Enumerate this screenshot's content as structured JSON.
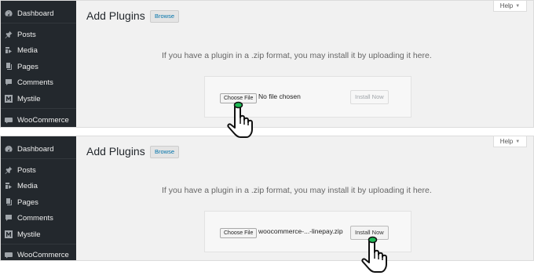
{
  "panels": [
    {
      "sidebar": {
        "items": [
          {
            "label": "Dashboard",
            "icon": "dashboard-icon"
          },
          {
            "label": "Posts",
            "icon": "pin-icon"
          },
          {
            "label": "Media",
            "icon": "media-icon"
          },
          {
            "label": "Pages",
            "icon": "pages-icon"
          },
          {
            "label": "Comments",
            "icon": "comment-icon"
          },
          {
            "label": "Mystile",
            "icon": "mystile-icon"
          },
          {
            "label": "WooCommerce",
            "icon": "woocommerce-icon"
          }
        ]
      },
      "page_title": "Add Plugins",
      "browse_label": "Browse",
      "help_label": "Help",
      "instruction": "If you have a plugin in a .zip format, you may install it by uploading it here.",
      "choose_file_label": "Choose File",
      "file_status": "No file chosen",
      "install_label": "Install Now",
      "install_enabled": false,
      "pointer_target": "choose-file-button"
    },
    {
      "sidebar": {
        "items": [
          {
            "label": "Dashboard",
            "icon": "dashboard-icon"
          },
          {
            "label": "Posts",
            "icon": "pin-icon"
          },
          {
            "label": "Media",
            "icon": "media-icon"
          },
          {
            "label": "Pages",
            "icon": "pages-icon"
          },
          {
            "label": "Comments",
            "icon": "comment-icon"
          },
          {
            "label": "Mystile",
            "icon": "mystile-icon"
          },
          {
            "label": "WooCommerce",
            "icon": "woocommerce-icon"
          }
        ]
      },
      "page_title": "Add Plugins",
      "browse_label": "Browse",
      "help_label": "Help",
      "instruction": "If you have a plugin in a .zip format, you may install it by uploading it here.",
      "choose_file_label": "Choose File",
      "file_status": "woocommerce-...-linepay.zip",
      "install_label": "Install Now",
      "install_enabled": true,
      "pointer_target": "install-now-button"
    }
  ],
  "colors": {
    "sidebar_bg": "#23282d",
    "content_bg": "#f1f1f1",
    "link_blue": "#0073aa",
    "click_indicator": "#1db954"
  }
}
